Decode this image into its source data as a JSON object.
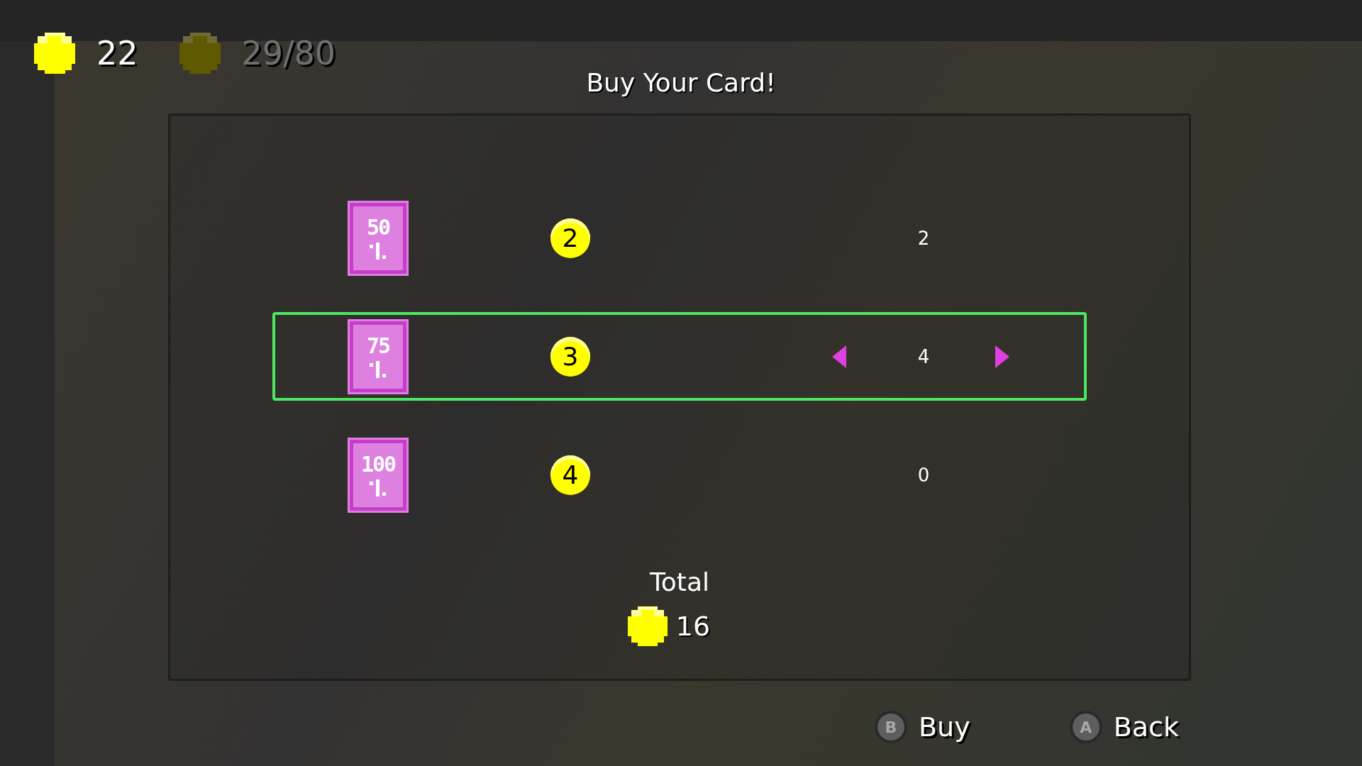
{
  "wallet": {
    "coins": "22",
    "collected": "29/80"
  },
  "title": "Buy Your Card!",
  "cards": [
    {
      "value": "50",
      "price": "2",
      "quantity": "2",
      "selected": false
    },
    {
      "value": "75",
      "price": "3",
      "quantity": "4",
      "selected": true
    },
    {
      "value": "100",
      "price": "4",
      "quantity": "0",
      "selected": false
    }
  ],
  "total": {
    "label": "Total",
    "amount": "16"
  },
  "buttons": [
    {
      "key": "B",
      "label": "Buy"
    },
    {
      "key": "A",
      "label": "Back"
    }
  ]
}
